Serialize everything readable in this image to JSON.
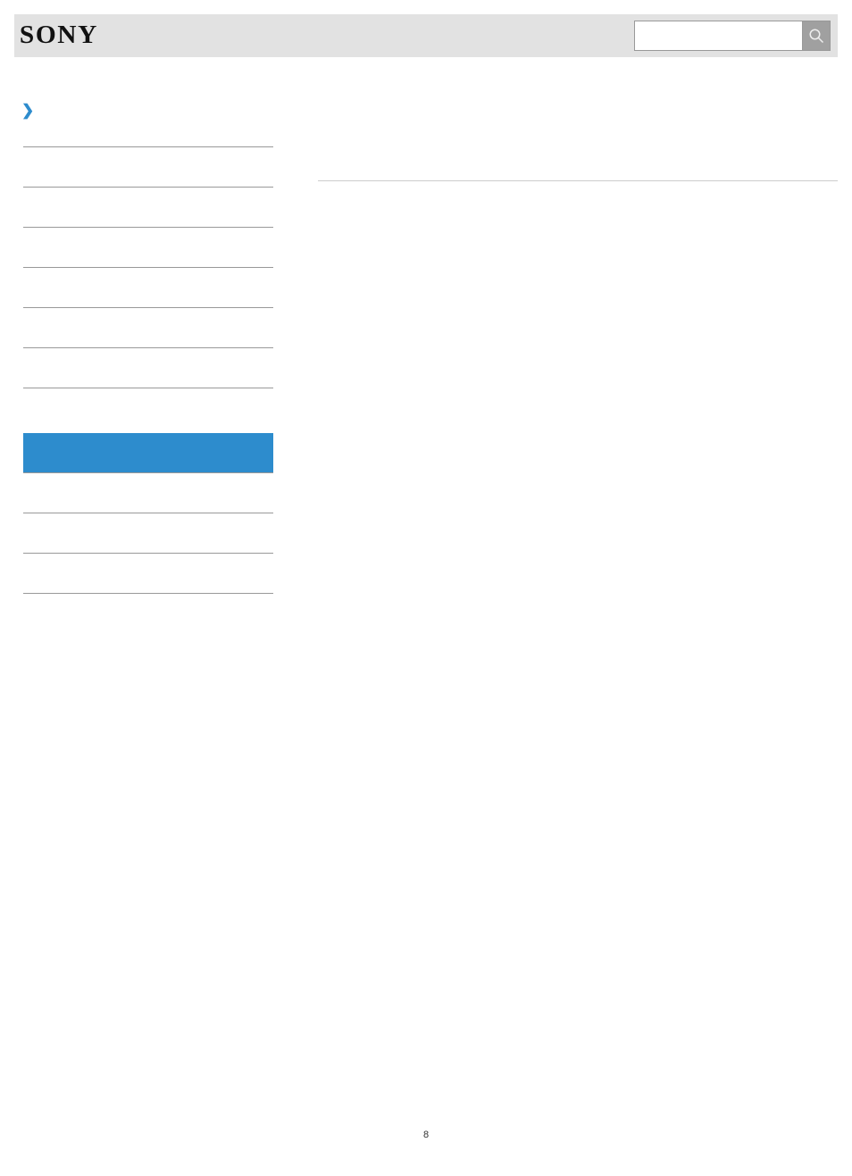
{
  "header": {
    "logo_text": "SONY",
    "search_placeholder": ""
  },
  "breadcrumb": {
    "items": []
  },
  "sidebar": {
    "top_items": [
      "",
      "",
      "",
      "",
      "",
      ""
    ],
    "bottom_items": [
      "",
      "",
      ""
    ],
    "active_index": 0
  },
  "main": {},
  "footer": {
    "page_number": "8"
  }
}
